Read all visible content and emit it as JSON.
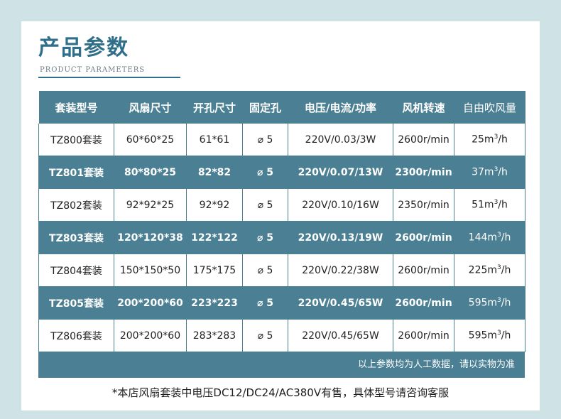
{
  "header": {
    "title": "产品参数",
    "subtitle": "PRODUCT PARAMETERS"
  },
  "table": {
    "columns": [
      "套装型号",
      "风扇尺寸",
      "开孔尺寸",
      "固定孔",
      "电压/电流/功率",
      "风机转速",
      "自由吹风量"
    ],
    "rows": [
      {
        "model": "TZ800套装",
        "fan_size": "60*60*25",
        "hole_size": "61*61",
        "fix_hole": "⌀ 5",
        "power": "220V/0.03/3W",
        "speed": "2600r/min",
        "flow_value": "25m",
        "flow_exp": "3",
        "flow_unit": "/h",
        "style": "light"
      },
      {
        "model": "TZ801套装",
        "fan_size": "80*80*25",
        "hole_size": "82*82",
        "fix_hole": "⌀ 5",
        "power": "220V/0.07/13W",
        "speed": "2300r/min",
        "flow_value": "37m",
        "flow_exp": "3",
        "flow_unit": "/h",
        "style": "dark"
      },
      {
        "model": "TZ802套装",
        "fan_size": "92*92*25",
        "hole_size": "92*92",
        "fix_hole": "⌀ 5",
        "power": "220V/0.10/16W",
        "speed": "2350r/min",
        "flow_value": "51m",
        "flow_exp": "3",
        "flow_unit": "/h",
        "style": "light"
      },
      {
        "model": "TZ803套装",
        "fan_size": "120*120*38",
        "hole_size": "122*122",
        "fix_hole": "⌀ 5",
        "power": "220V/0.13/19W",
        "speed": "2600r/min",
        "flow_value": "144m",
        "flow_exp": "3",
        "flow_unit": "/h",
        "style": "dark"
      },
      {
        "model": "TZ804套装",
        "fan_size": "150*150*50",
        "hole_size": "175*175",
        "fix_hole": "⌀ 5",
        "power": "220V/0.22/38W",
        "speed": "2600r/min",
        "flow_value": "225m",
        "flow_exp": "3",
        "flow_unit": "/h",
        "style": "light"
      },
      {
        "model": "TZ805套装",
        "fan_size": "200*200*60",
        "hole_size": "223*223",
        "fix_hole": "⌀ 5",
        "power": "220V/0.45/65W",
        "speed": "2600r/min",
        "flow_value": "595m",
        "flow_exp": "3",
        "flow_unit": "/h",
        "style": "dark"
      },
      {
        "model": "TZ806套装",
        "fan_size": "200*200*60",
        "hole_size": "283*283",
        "fix_hole": "⌀ 5",
        "power": "220V/0.45/65W",
        "speed": "2600r/min",
        "flow_value": "595m",
        "flow_exp": "3",
        "flow_unit": "/h",
        "style": "light"
      }
    ],
    "note": "以上参数均为人工数据，请以实物为准"
  },
  "footnote": "*本店风扇套装中电压DC12/DC24/AC380V有售，具体型号请咨询客服",
  "colors": {
    "background": "#cfe3e6",
    "accent": "#4b7f93",
    "title": "#2f6f8a"
  }
}
